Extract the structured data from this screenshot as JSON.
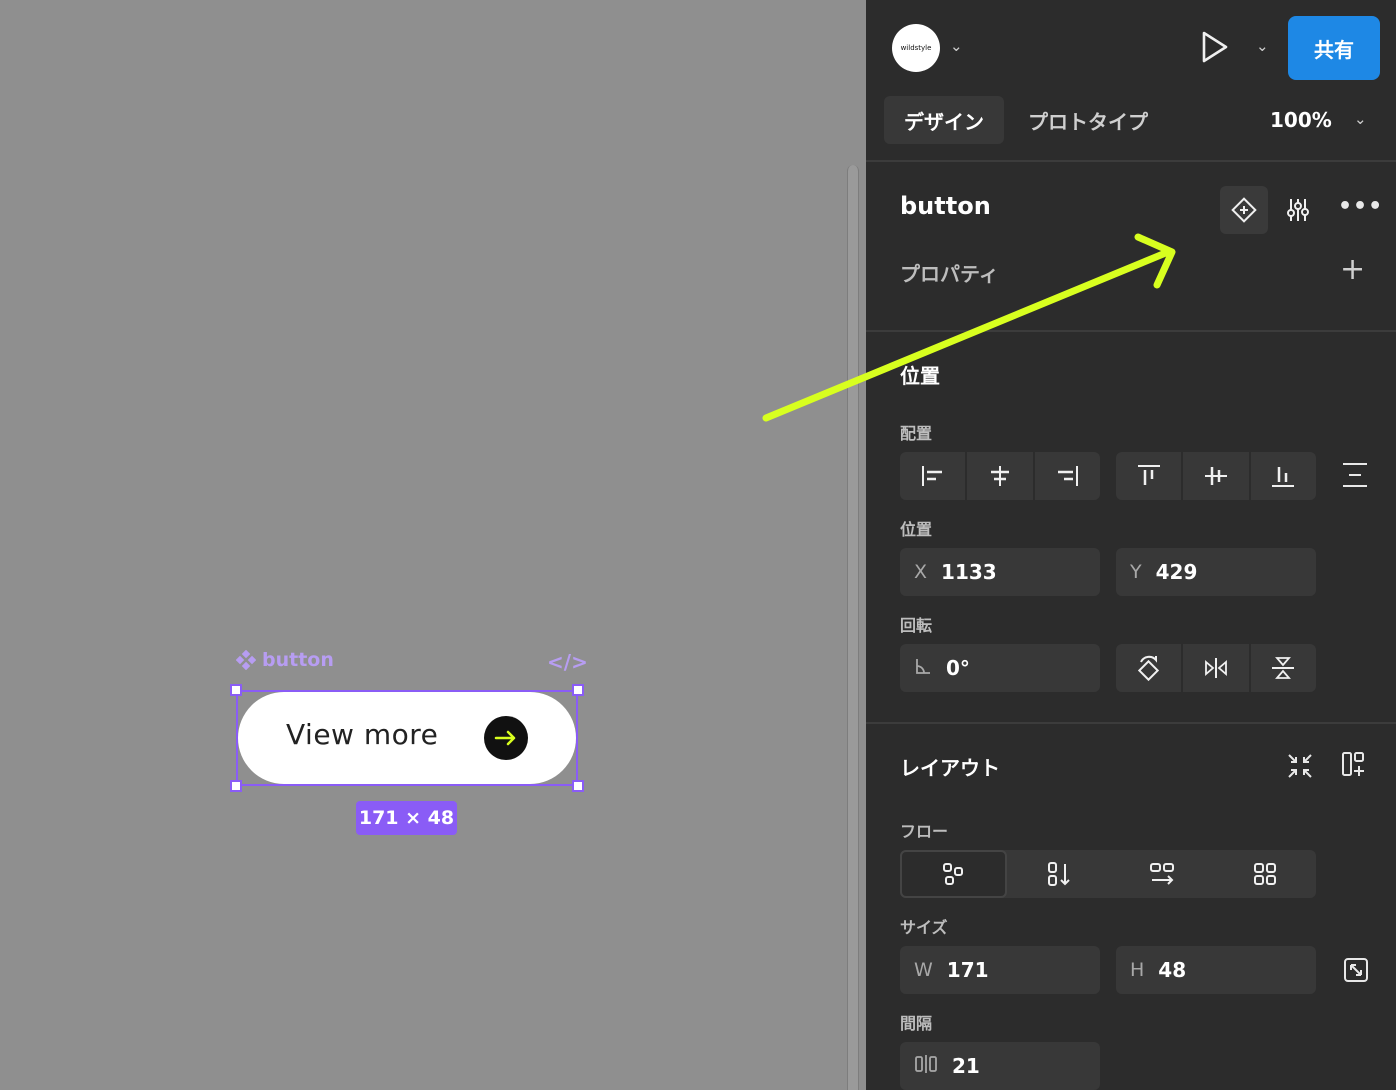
{
  "canvas": {
    "component_label": "button",
    "pill_text": "View more",
    "size_badge": "171 × 48"
  },
  "topbar": {
    "avatar_text": "wildstyle",
    "share_label": "共有"
  },
  "tabs": {
    "design": "デザイン",
    "prototype": "プロトタイプ",
    "zoom": "100%"
  },
  "component": {
    "name": "button",
    "properties_label": "プロパティ"
  },
  "position_section": {
    "title": "位置",
    "align_label": "配置",
    "position_label": "位置",
    "x_label": "X",
    "x_value": "1133",
    "y_label": "Y",
    "y_value": "429",
    "rotation_label": "回転",
    "rotation_value": "0°"
  },
  "layout_section": {
    "title": "レイアウト",
    "flow_label": "フロー",
    "size_label": "サイズ",
    "w_label": "W",
    "w_value": "171",
    "h_label": "H",
    "h_value": "48",
    "gap_label": "間隔",
    "gap_value": "21"
  },
  "colors": {
    "accent": "#1e88e5",
    "selection": "#8a5cf6",
    "annotation_arrow": "#d8ff1f",
    "panel_bg": "#2c2c2c",
    "canvas_bg": "#8f8f8f"
  }
}
